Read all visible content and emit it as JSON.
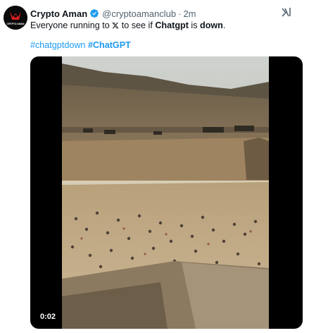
{
  "author": {
    "display_name": "Crypto Aman",
    "handle": "@cryptoamanclub",
    "separator": "·",
    "time": "2m",
    "verified": true,
    "avatar_icon": "logo-avatar-icon",
    "avatar_text": "CRYPTO AMAN"
  },
  "tweet": {
    "text_before": "Everyone running to ",
    "text_mid1": " to see if ",
    "text_bold1": "Chatgpt",
    "text_mid2": " is ",
    "text_bold2": "down",
    "text_end": "."
  },
  "hashtags": [
    "#chatgptdown",
    "#ChatGPT"
  ],
  "media": {
    "type": "video",
    "timestamp": "0:02"
  },
  "colors": {
    "link": "#1d9bf0",
    "verified": "#1d9bf0",
    "text": "#0f1419",
    "muted": "#536471"
  }
}
